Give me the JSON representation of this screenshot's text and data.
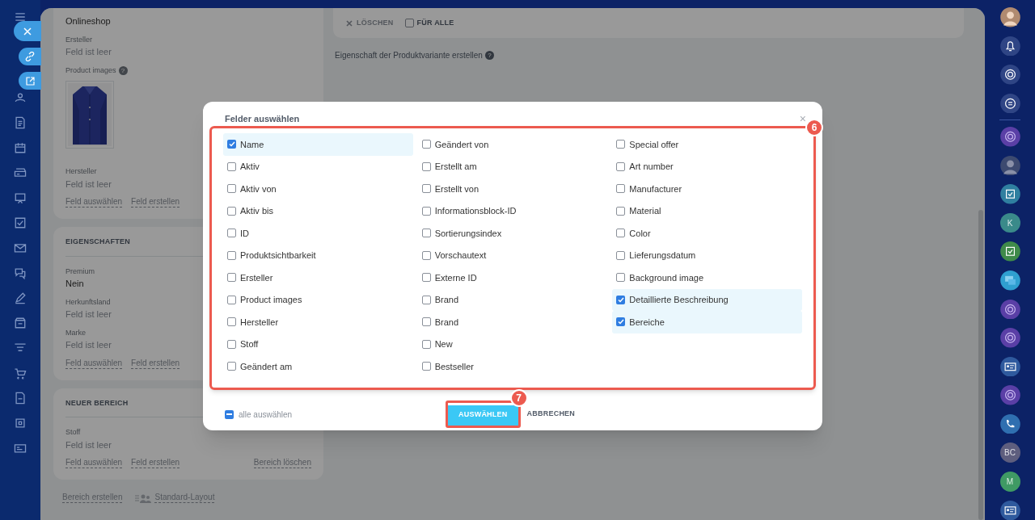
{
  "details": {
    "sections": [
      {
        "fields": [
          {
            "value": "Onlineshop",
            "empty": false
          },
          {
            "label": "Ersteller",
            "value": "Feld ist leer",
            "empty": true
          },
          {
            "label": "Product images",
            "help": "?",
            "kind": "picture"
          },
          {
            "label": "Hersteller",
            "value": "Feld ist leer",
            "empty": true
          }
        ],
        "links": [
          "Feld auswählen",
          "Feld erstellen"
        ]
      },
      {
        "title": "EIGENSCHAFTEN",
        "fields": [
          {
            "label": "Premium",
            "value": "Nein",
            "empty": false
          },
          {
            "label": "Herkunftsland",
            "value": "Feld ist leer",
            "empty": true
          },
          {
            "label": "Marke",
            "value": "Feld ist leer",
            "empty": true
          }
        ],
        "links": [
          "Feld auswählen",
          "Feld erstellen"
        ]
      },
      {
        "title": "NEUER BEREICH",
        "fields": [
          {
            "label": "Stoff",
            "value": "Feld ist leer",
            "empty": true
          }
        ],
        "links": [
          "Feld auswählen",
          "Feld erstellen"
        ],
        "delete_link": "Bereich löschen"
      }
    ],
    "footer_links": [
      "Bereich erstellen",
      "Standard-Layout"
    ]
  },
  "variant_toolbar": {
    "delete": "LÖSCHEN",
    "for_all": {
      "label": "FÜR ALLE",
      "checked": false
    }
  },
  "variant_property_link": "Eigenschaft der Produktvariante erstellen",
  "variant_property_help": "?",
  "dialog": {
    "title": "Felder auswählen",
    "close": "×",
    "callout": "6",
    "columns": [
      [
        {
          "label": "Name",
          "checked": true
        },
        {
          "label": "Aktiv",
          "checked": false
        },
        {
          "label": "Aktiv von",
          "checked": false
        },
        {
          "label": "Aktiv bis",
          "checked": false
        },
        {
          "label": "ID",
          "checked": false
        },
        {
          "label": "Produktsichtbarkeit",
          "checked": false
        },
        {
          "label": "Ersteller",
          "checked": false
        },
        {
          "label": "Product images",
          "checked": false
        },
        {
          "label": "Hersteller",
          "checked": false
        },
        {
          "label": "Stoff",
          "checked": false
        },
        {
          "label": "Geändert am",
          "checked": false
        }
      ],
      [
        {
          "label": "Geändert von",
          "checked": false
        },
        {
          "label": "Erstellt am",
          "checked": false
        },
        {
          "label": "Erstellt von",
          "checked": false
        },
        {
          "label": "Informationsblock-ID",
          "checked": false
        },
        {
          "label": "Sortierungsindex",
          "checked": false
        },
        {
          "label": "Vorschautext",
          "checked": false
        },
        {
          "label": "Externe ID",
          "checked": false
        },
        {
          "label": "Brand",
          "checked": false
        },
        {
          "label": "Brand",
          "checked": false
        },
        {
          "label": "New",
          "checked": false
        },
        {
          "label": "Bestseller",
          "checked": false
        }
      ],
      [
        {
          "label": "Special offer",
          "checked": false
        },
        {
          "label": "Art number",
          "checked": false
        },
        {
          "label": "Manufacturer",
          "checked": false
        },
        {
          "label": "Material",
          "checked": false
        },
        {
          "label": "Color",
          "checked": false
        },
        {
          "label": "Lieferungsdatum",
          "checked": false
        },
        {
          "label": "Background image",
          "checked": false
        },
        {
          "label": "Detaillierte Beschreibung",
          "checked": true
        },
        {
          "label": "Bereiche",
          "checked": true
        }
      ]
    ],
    "select_all": {
      "label": "alle auswählen",
      "indeterminate": true
    },
    "confirm": {
      "label": "AUSWÄHLEN",
      "callout": "7"
    },
    "cancel": "ABBRECHEN"
  },
  "right_sidebar": {
    "contacts": [
      {
        "initials": "K",
        "color": "#3a8a8a"
      },
      {
        "initials": "BC",
        "color": "#5e5e7e"
      },
      {
        "initials": "M",
        "color": "#3f9a64"
      }
    ]
  }
}
